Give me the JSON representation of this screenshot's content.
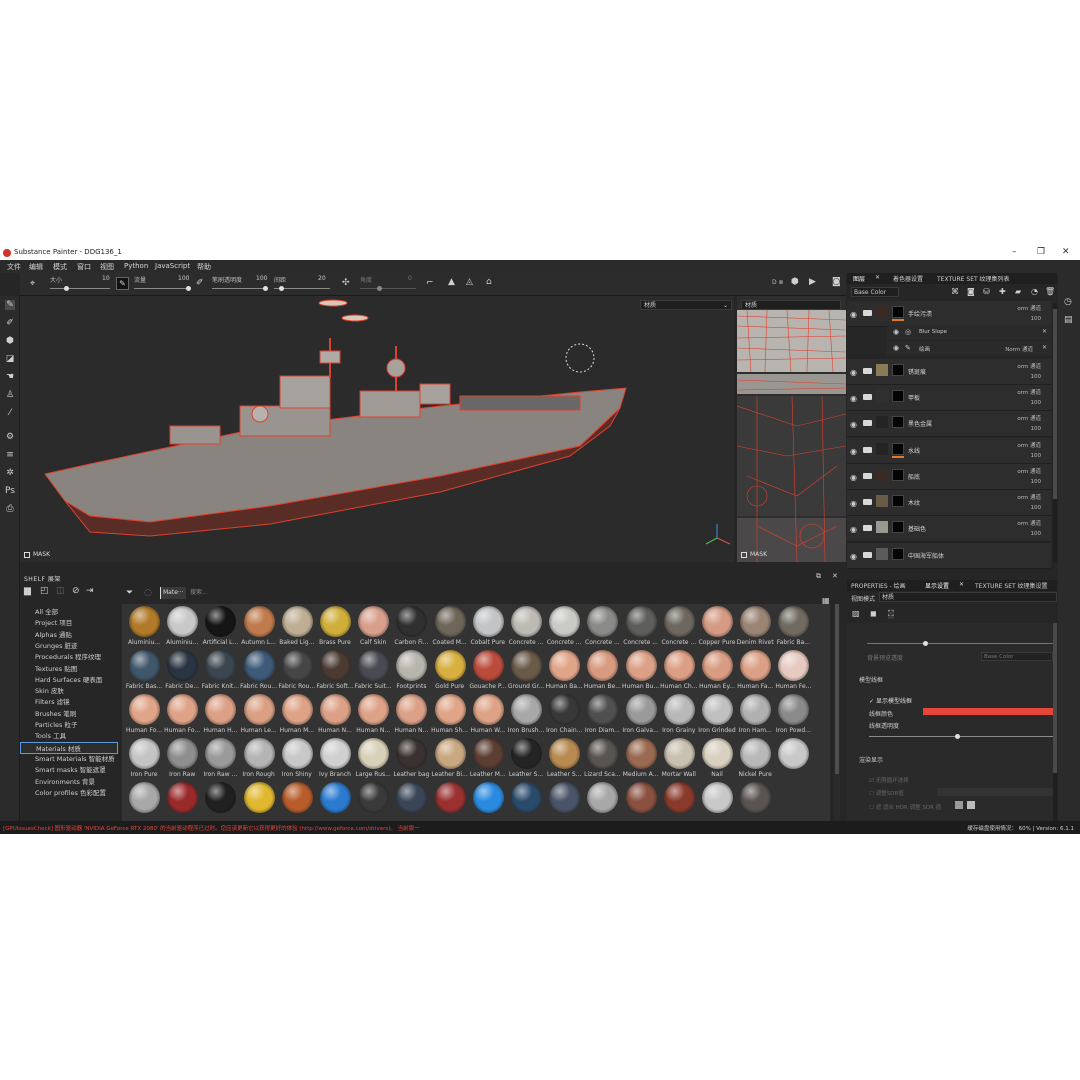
{
  "title_bar": {
    "title": "Substance Painter - DDG136_1",
    "minimize": "–",
    "maximize": "❐",
    "close": "✕"
  },
  "menu": [
    "文件",
    "编辑",
    "模式",
    "窗口",
    "视图",
    "Python",
    "JavaScript",
    "帮助"
  ],
  "toolbar": {
    "size_label": "大小",
    "size_value": "10",
    "flow_label": "流量",
    "flow_value": "100",
    "opacity_label": "笔刷透明度",
    "opacity_value": "100",
    "spacing_label": "间距",
    "spacing_value": "20",
    "angle_label": "角度",
    "angle_value": "0",
    "mode_label": "D ⊗"
  },
  "viewport": {
    "mode_select": "材质",
    "uv_select": "材质",
    "mask_label": "MASK",
    "uv_mask_label": "MASK"
  },
  "shelf": {
    "title": "SHELF 展架",
    "filter_tag": "Mate···",
    "search_placeholder": "搜索...",
    "categories": [
      "All 全部",
      "Project 项目",
      "Alphas 通贴",
      "Grunges 脏迹",
      "Procedurals 程序纹理",
      "Textures 贴图",
      "Hard Surfaces 硬表面",
      "Skin 皮肤",
      "Filters 滤镜",
      "Brushes 笔刷",
      "Particles 粒子",
      "Tools 工具",
      "Materials 材质",
      "Smart Materials 智能材质",
      "Smart masks 智能遮罩",
      "Environments 背景",
      "Color profiles 色彩配置"
    ],
    "selected_category": "Materials 材质",
    "materials": [
      {
        "name": "Aluminiu...",
        "color": "#b07a28"
      },
      {
        "name": "Aluminiu...",
        "color": "#c8c8c8"
      },
      {
        "name": "Artificial L...",
        "color": "#151515"
      },
      {
        "name": "Autumn L...",
        "color": "#c07a4c"
      },
      {
        "name": "Baked Lig...",
        "color": "#bfae94"
      },
      {
        "name": "Brass Pure",
        "color": "#cfae3a"
      },
      {
        "name": "Calf Skin",
        "color": "#d8a08c"
      },
      {
        "name": "Carbon Fi...",
        "color": "#303030"
      },
      {
        "name": "Coated M...",
        "color": "#6e6658"
      },
      {
        "name": "Cobalt Pure",
        "color": "#c2c4c6"
      },
      {
        "name": "Concrete ...",
        "color": "#bdbab3"
      },
      {
        "name": "Concrete ...",
        "color": "#c9c9c5"
      },
      {
        "name": "Concrete ...",
        "color": "#8a8a88"
      },
      {
        "name": "Concrete ...",
        "color": "#5e5e5c"
      },
      {
        "name": "Concrete ...",
        "color": "#6d675f"
      },
      {
        "name": "Copper Pure",
        "color": "#d49a84"
      },
      {
        "name": "Denim Rivet",
        "color": "#9a8474"
      },
      {
        "name": "Fabric Ba...",
        "color": "#706a60"
      },
      {
        "name": "Fabric Bas...",
        "color": "#40566a"
      },
      {
        "name": "Fabric De...",
        "color": "#2a3442"
      },
      {
        "name": "Fabric Knit...",
        "color": "#3c4650"
      },
      {
        "name": "Fabric Rou...",
        "color": "#3e5a78"
      },
      {
        "name": "Fabric Rou...",
        "color": "#464646"
      },
      {
        "name": "Fabric Soft...",
        "color": "#4a3a32"
      },
      {
        "name": "Fabric Suit...",
        "color": "#4a4a52"
      },
      {
        "name": "Footprints",
        "color": "#b8b4ae"
      },
      {
        "name": "Gold Pure",
        "color": "#d8b040"
      },
      {
        "name": "Gouache P...",
        "color": "#bb4c3c"
      },
      {
        "name": "Ground Gr...",
        "color": "#6a5a48"
      },
      {
        "name": "Human Ba...",
        "color": "#e0a488"
      },
      {
        "name": "Human Be...",
        "color": "#d89a80"
      },
      {
        "name": "Human Bu...",
        "color": "#dca086"
      },
      {
        "name": "Human Ch...",
        "color": "#dc9e84"
      },
      {
        "name": "Human Ey...",
        "color": "#d89c82"
      },
      {
        "name": "Human Fa...",
        "color": "#dca086"
      },
      {
        "name": "Human Fe...",
        "color": "#e6cac0"
      },
      {
        "name": "Human Fo...",
        "color": "#e0a488"
      },
      {
        "name": "Human Fo...",
        "color": "#dea286"
      },
      {
        "name": "Human H...",
        "color": "#dca086"
      },
      {
        "name": "Human Le...",
        "color": "#daa084"
      },
      {
        "name": "Human M...",
        "color": "#dea286"
      },
      {
        "name": "Human N...",
        "color": "#dca086"
      },
      {
        "name": "Human N...",
        "color": "#dea286"
      },
      {
        "name": "Human N...",
        "color": "#dca086"
      },
      {
        "name": "Human Sh...",
        "color": "#e0a488"
      },
      {
        "name": "Human W...",
        "color": "#dea286"
      },
      {
        "name": "Iron Brush...",
        "color": "#a8a8a8"
      },
      {
        "name": "Iron Chain...",
        "color": "#383838"
      },
      {
        "name": "Iron Diam...",
        "color": "#505050"
      },
      {
        "name": "Iron Galva...",
        "color": "#9a9a9a"
      },
      {
        "name": "Iron Grainy",
        "color": "#b8b8b8"
      },
      {
        "name": "Iron Grinded",
        "color": "#c0c0c0"
      },
      {
        "name": "Iron Ham...",
        "color": "#b0b0b0"
      },
      {
        "name": "Iron Powd...",
        "color": "#8a8a8a"
      },
      {
        "name": "Iron Pure",
        "color": "#c4c4c4"
      },
      {
        "name": "Iron Raw",
        "color": "#8e8e8e"
      },
      {
        "name": "Iron Raw ...",
        "color": "#9a9a9a"
      },
      {
        "name": "Iron Rough",
        "color": "#b4b4b4"
      },
      {
        "name": "Iron Shiny",
        "color": "#c8c8c8"
      },
      {
        "name": "Ivy Branch",
        "color": "#d0d0d0"
      },
      {
        "name": "Large Rus...",
        "color": "#d8d0b8"
      },
      {
        "name": "Leather bag",
        "color": "#3a3230"
      },
      {
        "name": "Leather Bi...",
        "color": "#c8a880"
      },
      {
        "name": "Leather M...",
        "color": "#5c3e32"
      },
      {
        "name": "Leather S...",
        "color": "#242424"
      },
      {
        "name": "Leather S...",
        "color": "#b88a50"
      },
      {
        "name": "Lizard Sca...",
        "color": "#585450"
      },
      {
        "name": "Medium A...",
        "color": "#9a6a50"
      },
      {
        "name": "Mortar Wall",
        "color": "#c8c0b0"
      },
      {
        "name": "Nail",
        "color": "#d8d0c0"
      },
      {
        "name": "Nickel Pure",
        "color": "#b8b8b8"
      },
      {
        "name": "",
        "color": "#c8c8c8"
      },
      {
        "name": "",
        "color": "#a8a8a8"
      },
      {
        "name": "",
        "color": "#9a2a2a"
      },
      {
        "name": "",
        "color": "#202020"
      },
      {
        "name": "",
        "color": "#e0b830"
      },
      {
        "name": "",
        "color": "#b85c2a"
      },
      {
        "name": "",
        "color": "#2a7ad0"
      },
      {
        "name": "",
        "color": "#3a3a3a"
      },
      {
        "name": "",
        "color": "#3a4658"
      },
      {
        "name": "",
        "color": "#9a3030"
      },
      {
        "name": "",
        "color": "#2a8ae0"
      },
      {
        "name": "",
        "color": "#2a4a6a"
      },
      {
        "name": "",
        "color": "#4a5468"
      },
      {
        "name": "",
        "color": "#a8a8a8"
      },
      {
        "name": "",
        "color": "#8a5040"
      },
      {
        "name": "",
        "color": "#8a3a2a"
      },
      {
        "name": "",
        "color": "#c8c8c8"
      },
      {
        "name": "",
        "color": "#5a5450"
      }
    ]
  },
  "right_panel": {
    "tabs_top": [
      "图层",
      "着色器设置",
      "TEXTURE SET 纹理集列表"
    ],
    "channel_select": "Base Color",
    "layers": [
      {
        "name": "手绘污渍",
        "blend": "orm 通道",
        "opacity": "100",
        "thumb": "#3a2824",
        "orange": true
      },
      {
        "name": "锈斑痕",
        "blend": "orm 通道",
        "opacity": "100",
        "thumb": "#8a7a58",
        "orange": false
      },
      {
        "name": "甲板",
        "blend": "orm 通道",
        "opacity": "100",
        "thumb": "#303030",
        "orange": false
      },
      {
        "name": "黑色金属",
        "blend": "orm 通道",
        "opacity": "100",
        "thumb": "#242424",
        "orange": false
      },
      {
        "name": "水线",
        "blend": "orm 通道",
        "opacity": "100",
        "thumb": "#242424",
        "orange": true
      },
      {
        "name": "船底",
        "blend": "orm 通道",
        "opacity": "100",
        "thumb": "#3a2a24",
        "orange": false
      },
      {
        "name": "木纹",
        "blend": "orm 通道",
        "opacity": "100",
        "thumb": "#6a5a48",
        "orange": false
      },
      {
        "name": "基础色",
        "blend": "orm 通道",
        "opacity": "100",
        "thumb": "#9a9890",
        "orange": false
      },
      {
        "name": "中国海军船体",
        "blend": "",
        "opacity": "",
        "thumb": "#5a5a5a",
        "orange": false
      }
    ],
    "sublayers": [
      {
        "name": "Blur Slope",
        "blend": "",
        "opacity": ""
      },
      {
        "name": "绘画",
        "blend": "Norm 通道",
        "opacity": "100"
      }
    ],
    "tabs_bottom": [
      "PROPERTIES - 绘画",
      "显示设置",
      "TEXTURE SET 纹理集设置"
    ],
    "view_mode_label": "视图模式",
    "view_mode_value": "材质",
    "props": {
      "bg_label": "背景预览透度",
      "channel_select": "Base Color",
      "wire_section": "模型线框",
      "show_wire": "显示模型线框",
      "wire_color_label": "线框颜色",
      "wire_color": "#e4463a",
      "wire_opacity_label": "线框透明度",
      "misc_section": "渲染显示",
      "opt1": "无限循环选择",
      "opt2": "调整SDR值",
      "opt3": "遮    适合 HDR 调整 SDR 值"
    }
  },
  "status": {
    "message": "[GPUIssuesCheck] 图形驱动器 'NVIDIA GeForce RTX 2080' 的当前驱动程序已过时。您应该更新它以获得更好的体验 (http://www.geforce.com/drivers)。 当前版一",
    "memory": "缓存磁盘使用情况：",
    "memory_value": "60%",
    "version": "Version: 6.1.1"
  }
}
